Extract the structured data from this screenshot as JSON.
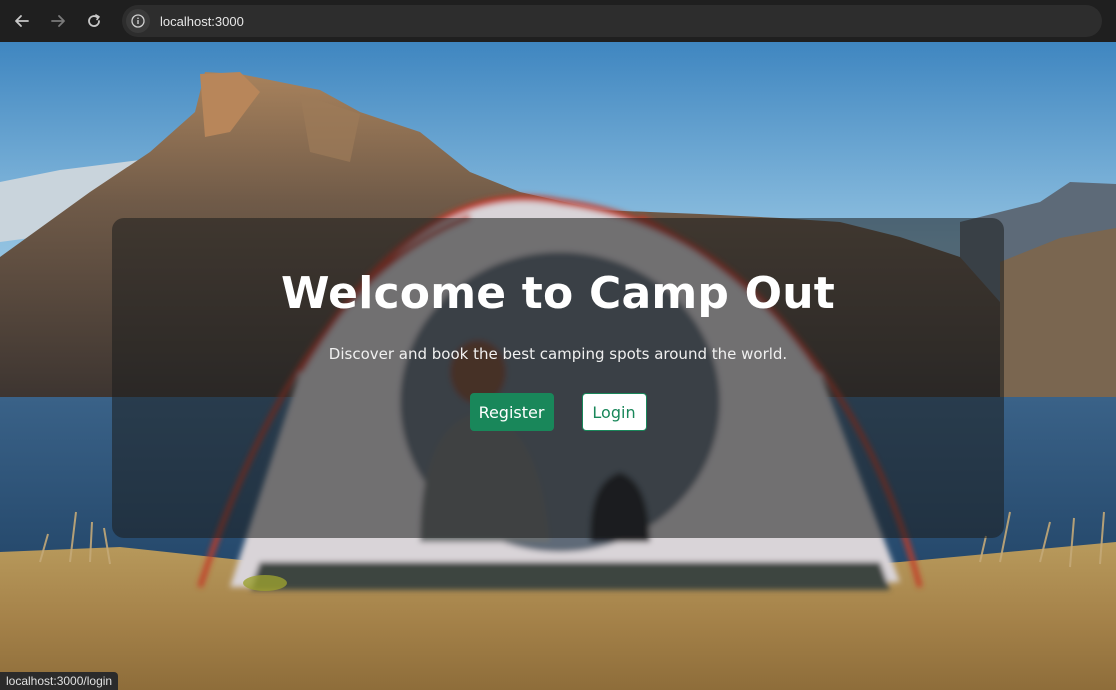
{
  "browser": {
    "url": "localhost:3000",
    "status_url": "localhost:3000/login"
  },
  "hero": {
    "title": "Welcome to Camp Out",
    "subtitle": "Discover and book the best camping spots around the world.",
    "register_label": "Register",
    "login_label": "Login"
  },
  "colors": {
    "accent": "#19875a",
    "card_overlay": "rgba(28,30,30,0.55)"
  }
}
